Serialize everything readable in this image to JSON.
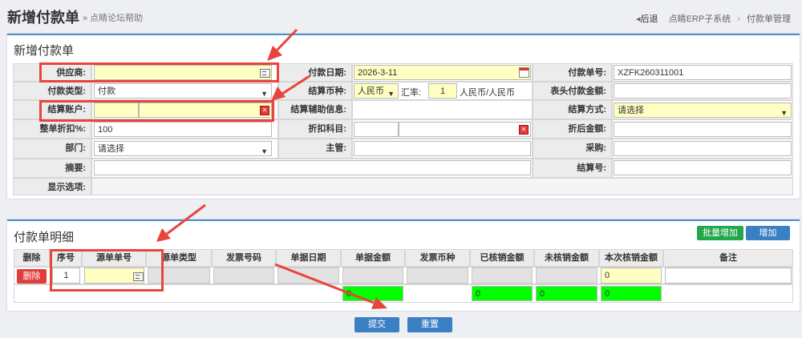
{
  "header": {
    "title": "新增付款单",
    "subtitle": "» 点睛论坛帮助",
    "back": "后退",
    "crumbs": [
      "点睛ERP子系统",
      "付款单管理"
    ]
  },
  "form": {
    "title": "新增付款单",
    "supplier_label": "供应商:",
    "supplier_value": "",
    "pay_date_label": "付款日期:",
    "pay_date_value": "2026-3-11",
    "pay_no_label": "付款单号:",
    "pay_no_value": "XZFK260311001",
    "pay_type_label": "付款类型:",
    "pay_type_value": "付款",
    "currency_label": "结算币种:",
    "currency_value": "人民币",
    "rate_label": "汇率:",
    "rate_value": "1",
    "rate_unit": "人民币/人民币",
    "header_amount_label": "表头付款金额:",
    "header_amount_value": "",
    "account_label": "结算账户:",
    "aux_label": "结算辅助信息:",
    "method_label": "结算方式:",
    "method_value": "请选择",
    "discount_label": "整单折扣%:",
    "discount_value": "100",
    "discount_subject_label": "折扣科目:",
    "after_discount_label": "折后金额:",
    "after_discount_value": "",
    "dept_label": "部门:",
    "dept_value": "请选择",
    "manager_label": "主管:",
    "manager_value": "",
    "purchase_label": "采购:",
    "purchase_value": "",
    "summary_label": "摘要:",
    "summary_value": "",
    "settle_no_label": "结算号:",
    "settle_no_value": "",
    "display_label": "显示选项:"
  },
  "detail": {
    "title": "付款单明细",
    "batch_add": "批量增加",
    "add": "增加",
    "columns": [
      "删除",
      "序号",
      "源单单号",
      "源单类型",
      "发票号码",
      "单据日期",
      "单据金额",
      "发票币种",
      "已核销金额",
      "未核销金额",
      "本次核销金额",
      "备注"
    ],
    "row": {
      "delete": "删除",
      "seq": "1",
      "this_amount": "0",
      "total_doc_amount": "0",
      "total_verified": "0",
      "total_unverified": "0",
      "total_this": "0"
    }
  },
  "actions": {
    "submit": "提交",
    "reset": "重置"
  },
  "colors": {
    "annotation": "#e8453c",
    "required_field": "#ffffc2",
    "sum_field": "#00ff00",
    "primary": "#3b7fc4"
  }
}
